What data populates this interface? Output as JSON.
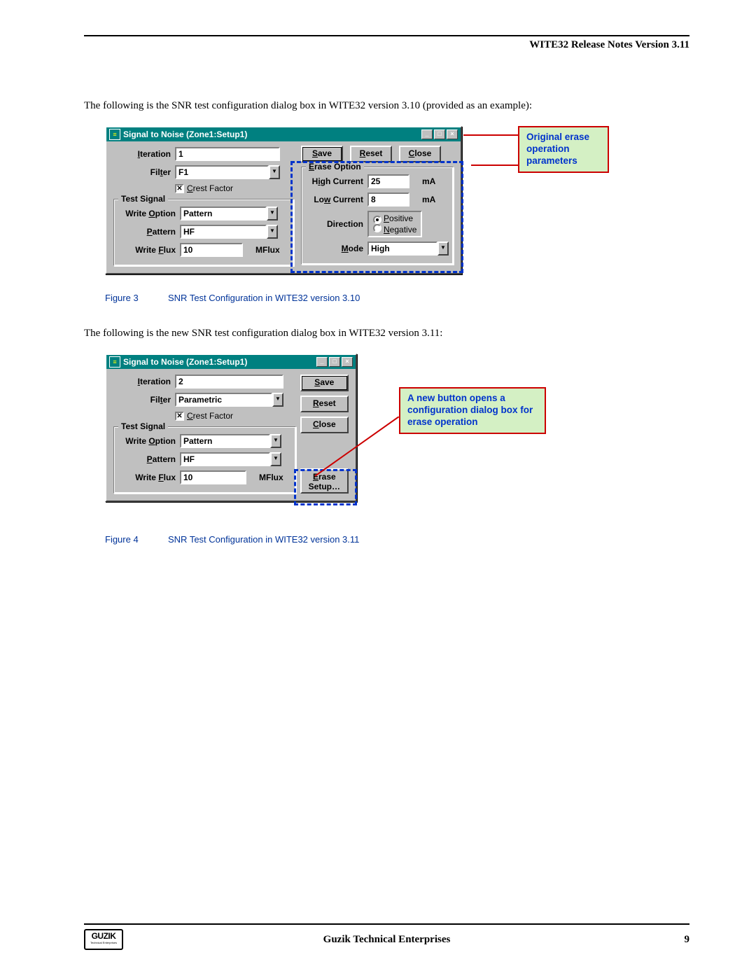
{
  "header": {
    "title": "WITE32 Release Notes Version 3.11"
  },
  "para1": "The following is the SNR test configuration dialog box in WITE32 version 3.10 (provided as an example):",
  "para2": "The following is the new SNR test configuration dialog box in WITE32 version 3.11:",
  "dlg1": {
    "title": "Signal to Noise (Zone1:Setup1)",
    "iteration_label": "Iteration",
    "iteration_value": "1",
    "filter_label": "Filter",
    "filter_value": "F1",
    "crest_label": "Crest Factor",
    "test_signal_title": "Test Signal",
    "write_option_label": "Write Option",
    "write_option_value": "Pattern",
    "pattern_label": "Pattern",
    "pattern_value": "HF",
    "write_flux_label": "Write Flux",
    "write_flux_value": "10",
    "write_flux_unit": "MFlux",
    "buttons": {
      "save": "Save",
      "reset": "Reset",
      "close": "Close"
    },
    "erase_option_title": "Erase Option",
    "high_current_label": "High Current",
    "high_current_value": "25",
    "low_current_label": "Low Current",
    "low_current_value": "8",
    "ma": "mA",
    "direction_label": "Direction",
    "positive": "Positive",
    "negative": "Negative",
    "mode_label": "Mode",
    "mode_value": "High"
  },
  "dlg2": {
    "title": "Signal to Noise (Zone1:Setup1)",
    "iteration_label": "Iteration",
    "iteration_value": "2",
    "filter_label": "Filter",
    "filter_value": "Parametric",
    "crest_label": "Crest Factor",
    "test_signal_title": "Test Signal",
    "write_option_label": "Write Option",
    "write_option_value": "Pattern",
    "pattern_label": "Pattern",
    "pattern_value": "HF",
    "write_flux_label": "Write Flux",
    "write_flux_value": "10",
    "write_flux_unit": "MFlux",
    "buttons": {
      "save": "Save",
      "reset": "Reset",
      "close": "Close",
      "erase_setup": "Erase\nSetup…"
    }
  },
  "callout1": "Original erase operation parameters",
  "callout2": "A new button opens a configuration dialog box for erase operation",
  "fig3": {
    "label": "Figure 3",
    "caption": "SNR Test Configuration in WITE32 version 3.10"
  },
  "fig4": {
    "label": "Figure 4",
    "caption": "SNR Test Configuration in WITE32 version 3.11"
  },
  "footer": {
    "company": "Guzik Technical Enterprises",
    "page": "9",
    "logo": "GUZIK",
    "logo_sub": "Technical Enterprises"
  }
}
